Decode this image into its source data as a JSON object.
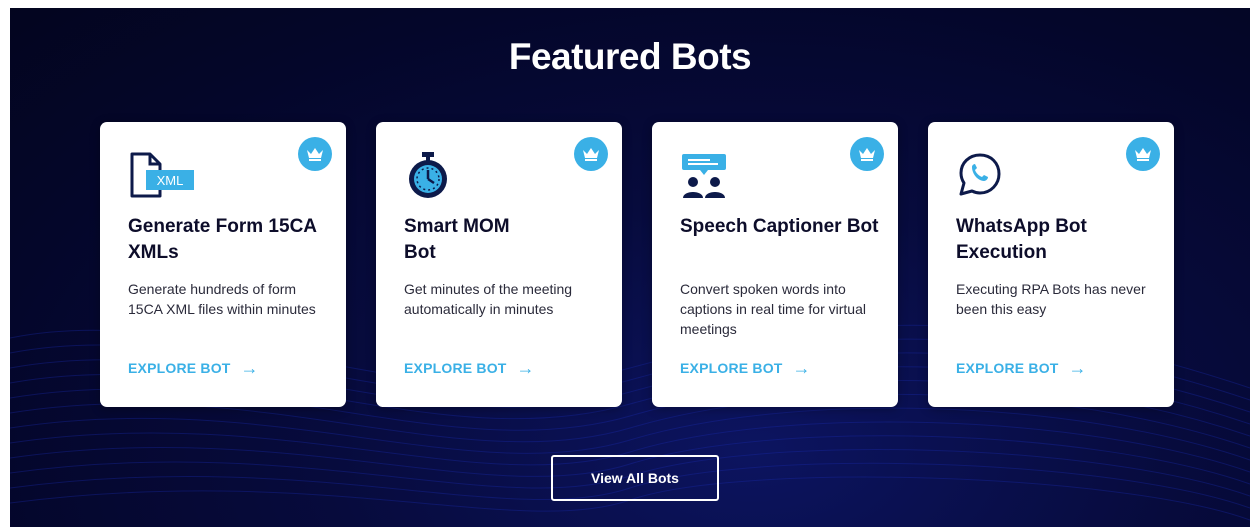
{
  "section": {
    "title": "Featured Bots",
    "view_all_label": "View All Bots"
  },
  "colors": {
    "background": "#04062a",
    "accent": "#3ab0e6",
    "card_bg": "#ffffff",
    "heading": "#0d0d2a"
  },
  "cards": [
    {
      "icon": "xml-file-icon",
      "icon_text": "XML",
      "title": "Generate Form 15CA XMLs",
      "description": "Generate hundreds of form 15CA XML files within minutes",
      "link_label": "EXPLORE BOT",
      "badge_icon": "crown-icon"
    },
    {
      "icon": "stopwatch-icon",
      "title": "Smart MOM Bot",
      "description": "Get minutes of the meeting automatically in minutes",
      "link_label": "EXPLORE BOT",
      "badge_icon": "crown-icon"
    },
    {
      "icon": "captioner-icon",
      "title": "Speech Captioner Bot",
      "description": "Convert spoken words into captions in real time for virtual meetings",
      "link_label": "EXPLORE BOT",
      "badge_icon": "crown-icon"
    },
    {
      "icon": "whatsapp-icon",
      "title": "WhatsApp Bot Execution",
      "description": "Executing RPA Bots has never been this easy",
      "link_label": "EXPLORE BOT",
      "badge_icon": "crown-icon"
    }
  ]
}
